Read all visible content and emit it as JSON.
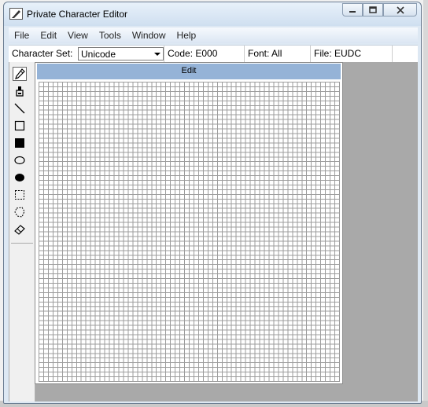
{
  "window": {
    "title": "Private Character Editor"
  },
  "menu": [
    "File",
    "Edit",
    "View",
    "Tools",
    "Window",
    "Help"
  ],
  "status": {
    "charset_label": "Character Set:",
    "charset_value": "Unicode",
    "code": "Code: E000",
    "font": "Font: All",
    "file": "File: EUDC"
  },
  "tools": [
    "pencil-icon",
    "brush-icon",
    "line-icon",
    "hollow-rectangle-icon",
    "filled-rectangle-icon",
    "hollow-ellipse-icon",
    "filled-ellipse-icon",
    "rectangular-selection-icon",
    "freeform-selection-icon",
    "eraser-icon"
  ],
  "edit_window": {
    "title": "Edit",
    "grid_size": 64
  },
  "colors": {
    "edit_titlebar": "#95b3d7",
    "client_bg": "#a9a9a9",
    "grid_line": "#9c9c9c"
  }
}
